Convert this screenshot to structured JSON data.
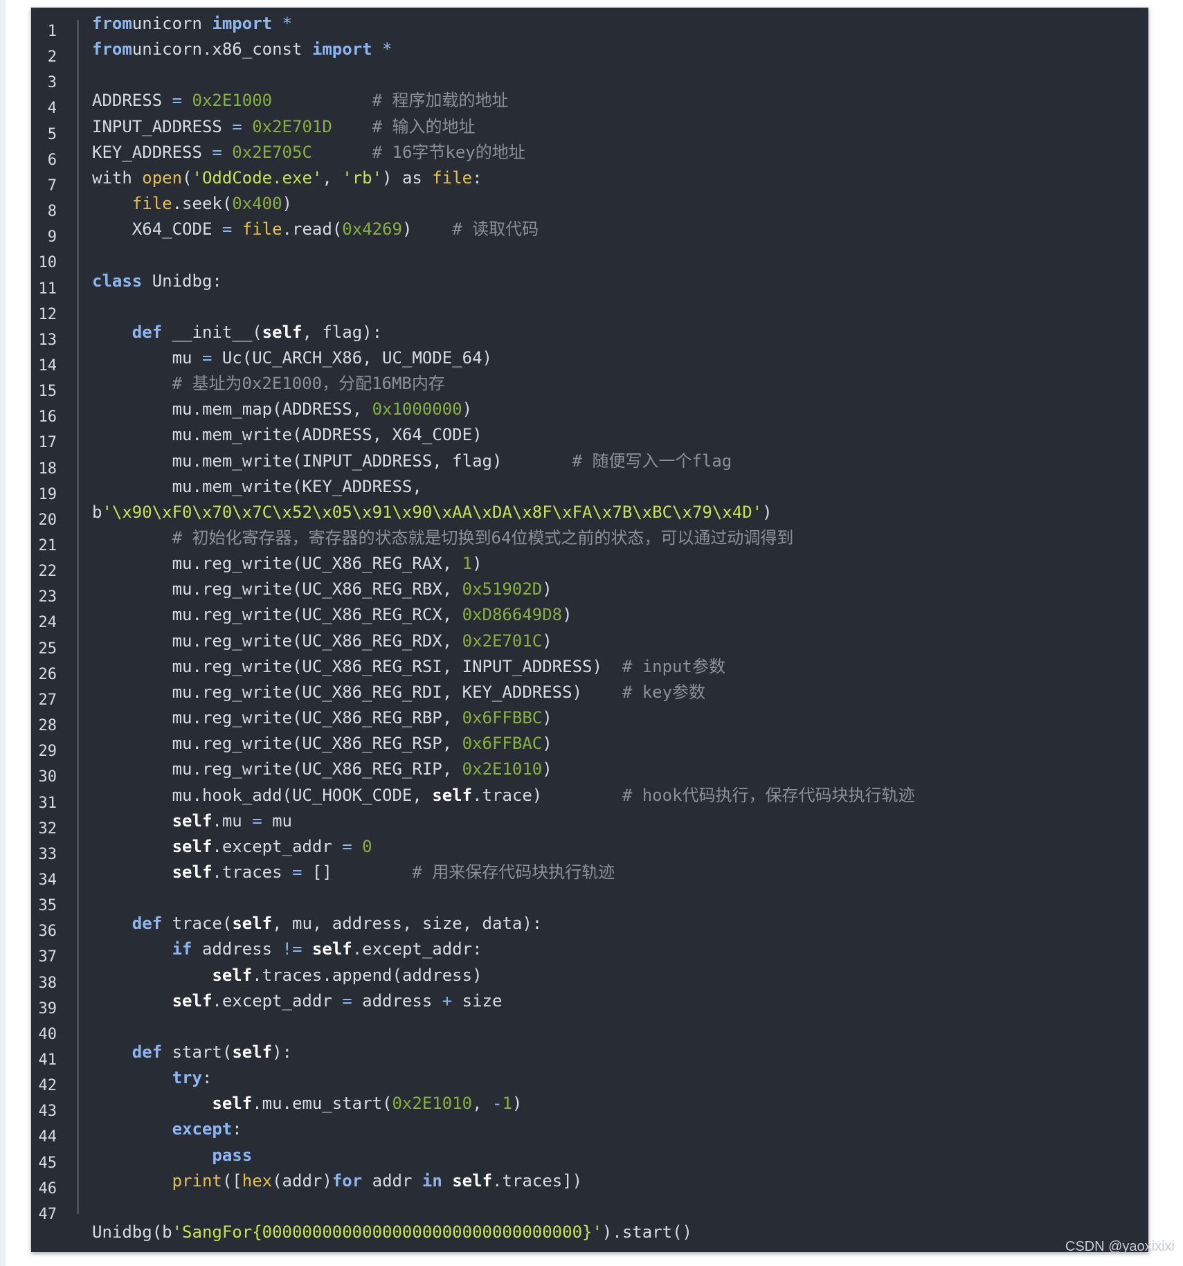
{
  "line_numbers": [
    "1",
    "2",
    "3",
    "4",
    "5",
    "6",
    "7",
    "8",
    "9",
    "10",
    "11",
    "12",
    "13",
    "14",
    "15",
    "16",
    "17",
    "18",
    "19",
    "20",
    "21",
    "22",
    "23",
    "24",
    "25",
    "26",
    "27",
    "28",
    "29",
    "30",
    "31",
    "32",
    "33",
    "34",
    "35",
    "36",
    "37",
    "38",
    "39",
    "40",
    "41",
    "42",
    "43",
    "44",
    "45",
    "46",
    "47"
  ],
  "code_lines": [
    [
      [
        "kw",
        "from"
      ],
      [
        "",
        "unicorn "
      ],
      [
        "kw",
        "import"
      ],
      [
        "op",
        " *"
      ]
    ],
    [
      [
        "kw",
        "from"
      ],
      [
        "",
        "unicorn.x86_const "
      ],
      [
        "kw",
        "import"
      ],
      [
        "op",
        " *"
      ]
    ],
    [],
    [
      [
        "",
        "ADDRESS "
      ],
      [
        "op",
        "="
      ],
      [
        "num",
        " 0x2E1000"
      ],
      [
        "",
        "          "
      ],
      [
        "cmt",
        "# 程序加载的地址"
      ]
    ],
    [
      [
        "",
        "INPUT_ADDRESS "
      ],
      [
        "op",
        "="
      ],
      [
        "num",
        " 0x2E701D"
      ],
      [
        "",
        "    "
      ],
      [
        "cmt",
        "# 输入的地址"
      ]
    ],
    [
      [
        "",
        "KEY_ADDRESS "
      ],
      [
        "op",
        "="
      ],
      [
        "num",
        " 0x2E705C"
      ],
      [
        "",
        "      "
      ],
      [
        "cmt",
        "# 16字节key的地址"
      ]
    ],
    [
      [
        "",
        "with "
      ],
      [
        "bi",
        "open"
      ],
      [
        "",
        "("
      ],
      [
        "str",
        "'OddCode.exe'"
      ],
      [
        "",
        ", "
      ],
      [
        "str",
        "'rb'"
      ],
      [
        "",
        ") as "
      ],
      [
        "bi",
        "file"
      ],
      [
        "",
        ":"
      ]
    ],
    [
      [
        "",
        "    "
      ],
      [
        "bi",
        "file"
      ],
      [
        "",
        ".seek("
      ],
      [
        "num",
        "0x400"
      ],
      [
        "",
        ")"
      ]
    ],
    [
      [
        "",
        "    X64_CODE "
      ],
      [
        "op",
        "="
      ],
      [
        "bi",
        " file"
      ],
      [
        "",
        ".read("
      ],
      [
        "num",
        "0x4269"
      ],
      [
        "",
        ")    "
      ],
      [
        "cmt",
        "# 读取代码"
      ]
    ],
    [],
    [
      [
        "kw",
        "class"
      ],
      [
        "",
        " Unidbg:"
      ]
    ],
    [],
    [
      [
        "",
        "    "
      ],
      [
        "kw",
        "def"
      ],
      [
        "",
        " __init__("
      ],
      [
        "slf",
        "self"
      ],
      [
        "",
        ", flag):"
      ]
    ],
    [
      [
        "",
        "        mu "
      ],
      [
        "op",
        "="
      ],
      [
        "",
        " Uc(UC_ARCH_X86, UC_MODE_64)"
      ]
    ],
    [
      [
        "",
        "        "
      ],
      [
        "cmt",
        "# 基址为0x2E1000，分配16MB内存"
      ]
    ],
    [
      [
        "",
        "        mu.mem_map(ADDRESS, "
      ],
      [
        "num",
        "0x1000000"
      ],
      [
        "",
        ")"
      ]
    ],
    [
      [
        "",
        "        mu.mem_write(ADDRESS, X64_CODE)"
      ]
    ],
    [
      [
        "",
        "        mu.mem_write(INPUT_ADDRESS, flag)       "
      ],
      [
        "cmt",
        "# 随便写入一个flag"
      ]
    ],
    [
      [
        "",
        "        mu.mem_write(KEY_ADDRESS,"
      ]
    ],
    [
      [
        "",
        "b"
      ],
      [
        "str",
        "'\\x90\\xF0\\x70\\x7C\\x52\\x05\\x91\\x90\\xAA\\xDA\\x8F\\xFA\\x7B\\xBC\\x79\\x4D'"
      ],
      [
        "",
        ")"
      ]
    ],
    [
      [
        "",
        "        "
      ],
      [
        "cmt",
        "# 初始化寄存器，寄存器的状态就是切换到64位模式之前的状态，可以通过动调得到"
      ]
    ],
    [
      [
        "",
        "        mu.reg_write(UC_X86_REG_RAX, "
      ],
      [
        "num",
        "1"
      ],
      [
        "",
        ")"
      ]
    ],
    [
      [
        "",
        "        mu.reg_write(UC_X86_REG_RBX, "
      ],
      [
        "num",
        "0x51902D"
      ],
      [
        "",
        ")"
      ]
    ],
    [
      [
        "",
        "        mu.reg_write(UC_X86_REG_RCX, "
      ],
      [
        "num",
        "0xD86649D8"
      ],
      [
        "",
        ")"
      ]
    ],
    [
      [
        "",
        "        mu.reg_write(UC_X86_REG_RDX, "
      ],
      [
        "num",
        "0x2E701C"
      ],
      [
        "",
        ")"
      ]
    ],
    [
      [
        "",
        "        mu.reg_write(UC_X86_REG_RSI, INPUT_ADDRESS)  "
      ],
      [
        "cmt",
        "# input参数"
      ]
    ],
    [
      [
        "",
        "        mu.reg_write(UC_X86_REG_RDI, KEY_ADDRESS)    "
      ],
      [
        "cmt",
        "# key参数"
      ]
    ],
    [
      [
        "",
        "        mu.reg_write(UC_X86_REG_RBP, "
      ],
      [
        "num",
        "0x6FFBBC"
      ],
      [
        "",
        ")"
      ]
    ],
    [
      [
        "",
        "        mu.reg_write(UC_X86_REG_RSP, "
      ],
      [
        "num",
        "0x6FFBAC"
      ],
      [
        "",
        ")"
      ]
    ],
    [
      [
        "",
        "        mu.reg_write(UC_X86_REG_RIP, "
      ],
      [
        "num",
        "0x2E1010"
      ],
      [
        "",
        ")"
      ]
    ],
    [
      [
        "",
        "        mu.hook_add(UC_HOOK_CODE, "
      ],
      [
        "slf",
        "self"
      ],
      [
        "",
        ".trace)        "
      ],
      [
        "cmt",
        "# hook代码执行，保存代码块执行轨迹"
      ]
    ],
    [
      [
        "",
        "        "
      ],
      [
        "slf",
        "self"
      ],
      [
        "",
        ".mu "
      ],
      [
        "op",
        "="
      ],
      [
        "",
        " mu"
      ]
    ],
    [
      [
        "",
        "        "
      ],
      [
        "slf",
        "self"
      ],
      [
        "",
        ".except_addr "
      ],
      [
        "op",
        "="
      ],
      [
        "num",
        " 0"
      ]
    ],
    [
      [
        "",
        "        "
      ],
      [
        "slf",
        "self"
      ],
      [
        "",
        ".traces "
      ],
      [
        "op",
        "="
      ],
      [
        "",
        " []        "
      ],
      [
        "cmt",
        "# 用来保存代码块执行轨迹"
      ]
    ],
    [],
    [
      [
        "",
        "    "
      ],
      [
        "kw",
        "def"
      ],
      [
        "",
        " trace("
      ],
      [
        "slf",
        "self"
      ],
      [
        "",
        ", mu, address, size, data):"
      ]
    ],
    [
      [
        "",
        "        "
      ],
      [
        "kw",
        "if"
      ],
      [
        "",
        " address "
      ],
      [
        "op",
        "!="
      ],
      [
        "slf",
        " self"
      ],
      [
        "",
        ".except_addr:"
      ]
    ],
    [
      [
        "",
        "            "
      ],
      [
        "slf",
        "self"
      ],
      [
        "",
        ".traces.append(address)"
      ]
    ],
    [
      [
        "",
        "        "
      ],
      [
        "slf",
        "self"
      ],
      [
        "",
        ".except_addr "
      ],
      [
        "op",
        "="
      ],
      [
        "",
        " address "
      ],
      [
        "op",
        "+"
      ],
      [
        "",
        " size"
      ]
    ],
    [],
    [
      [
        "",
        "    "
      ],
      [
        "kw",
        "def"
      ],
      [
        "",
        " start("
      ],
      [
        "slf",
        "self"
      ],
      [
        "",
        "):"
      ]
    ],
    [
      [
        "",
        "        "
      ],
      [
        "kw",
        "try"
      ],
      [
        "",
        ":"
      ]
    ],
    [
      [
        "",
        "            "
      ],
      [
        "slf",
        "self"
      ],
      [
        "",
        ".mu.emu_start("
      ],
      [
        "num",
        "0x2E1010"
      ],
      [
        "",
        ", "
      ],
      [
        "op",
        "-"
      ],
      [
        "num",
        "1"
      ],
      [
        "",
        ")"
      ]
    ],
    [
      [
        "",
        "        "
      ],
      [
        "kw",
        "except"
      ],
      [
        "",
        ":"
      ]
    ],
    [
      [
        "",
        "            "
      ],
      [
        "kw",
        "pass"
      ]
    ],
    [
      [
        "",
        "        "
      ],
      [
        "bi",
        "print"
      ],
      [
        "",
        "(["
      ],
      [
        "bi",
        "hex"
      ],
      [
        "",
        "(addr)"
      ],
      [
        "kw",
        "for"
      ],
      [
        "",
        " addr "
      ],
      [
        "kw",
        "in"
      ],
      [
        "slf",
        " self"
      ],
      [
        "",
        ".traces])"
      ]
    ],
    [],
    [
      [
        "",
        "Unidbg(b"
      ],
      [
        "str",
        "'SangFor{00000000000000000000000000000000}'"
      ],
      [
        "",
        ").start()"
      ]
    ]
  ],
  "watermark": "CSDN @yaoxixixi"
}
